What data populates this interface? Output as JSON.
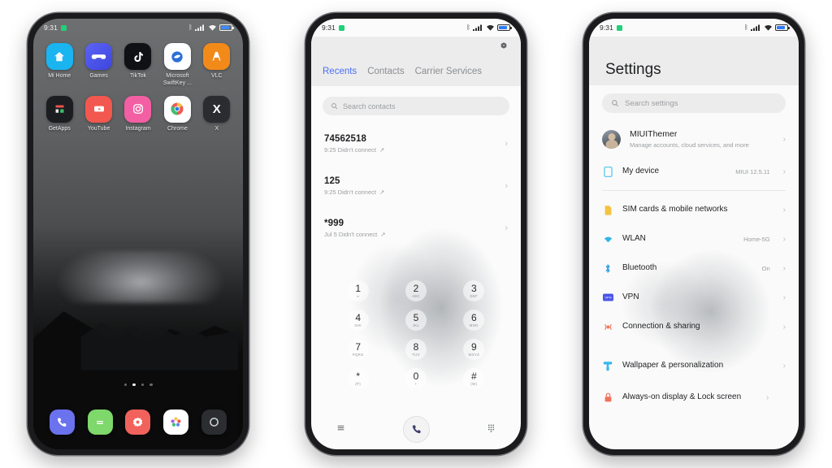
{
  "meta": {
    "background_color": "#ffffff",
    "device_frame_color": "#1b1b1d"
  },
  "status_bar": {
    "time": "9:31",
    "icons": {
      "bluetooth": "bluetooth-icon",
      "signal": "cellular-signal-icon",
      "wifi": "wifi-icon",
      "battery": "battery-icon"
    }
  },
  "phone1_home": {
    "apps_row1": [
      {
        "label": "Mi Home",
        "icon": "mi-home-icon",
        "color": "#1ab4f0",
        "glyph": "◆"
      },
      {
        "label": "Games",
        "icon": "games-icon",
        "color": "#4b55e8",
        "glyph": "Ἲe"
      },
      {
        "label": "TikTok",
        "icon": "tiktok-icon",
        "color": "#101114",
        "glyph": "♪"
      },
      {
        "label": "Microsoft SwiftKey ...",
        "icon": "swiftkey-icon",
        "color": "#ffffff",
        "glyph": "◉"
      },
      {
        "label": "VLC",
        "icon": "vlc-icon",
        "color": "#f28a1a",
        "glyph": "▲"
      }
    ],
    "apps_row2": [
      {
        "label": "GetApps",
        "icon": "getapps-icon",
        "color": "#1c1d20",
        "glyph": "■"
      },
      {
        "label": "YouTube",
        "icon": "youtube-icon",
        "color": "#f2584f",
        "glyph": "▶"
      },
      {
        "label": "Instagram",
        "icon": "instagram-icon",
        "color": "#f25fa3",
        "glyph": "◎"
      },
      {
        "label": "Chrome",
        "icon": "chrome-icon",
        "color": "#ffffff",
        "glyph": "◉"
      },
      {
        "label": "X",
        "icon": "x-icon",
        "color": "#2a2c30",
        "glyph": "X"
      }
    ],
    "page_dots": {
      "count": 4,
      "active_index": 1
    },
    "dock": [
      {
        "name": "phone-app",
        "icon": "phone-icon",
        "color": "#6b72ee",
        "glyph": "✆"
      },
      {
        "name": "messages-app",
        "icon": "messages-icon",
        "color": "#7ed86b",
        "glyph": "☰"
      },
      {
        "name": "settings-app",
        "icon": "settings-gear-icon",
        "color": "#f2625c",
        "glyph": "⚙"
      },
      {
        "name": "gallery-app",
        "icon": "gallery-icon",
        "color": "#ffffff",
        "glyph": "✸"
      },
      {
        "name": "camera-app",
        "icon": "camera-icon",
        "color": "#2b2d31",
        "glyph": "◎"
      }
    ]
  },
  "phone2_dialer": {
    "settings_icon": "gear-icon",
    "tabs": [
      {
        "label": "Recents",
        "active": true
      },
      {
        "label": "Contacts",
        "active": false
      },
      {
        "label": "Carrier Services",
        "active": false
      }
    ],
    "search": {
      "placeholder": "Search contacts",
      "icon": "search-icon"
    },
    "calls": [
      {
        "number": "74562518",
        "detail": "9:25 Didn't connect",
        "direction_icon": "outgoing-arrow-icon"
      },
      {
        "number": "125",
        "detail": "9:25 Didn't connect",
        "direction_icon": "outgoing-arrow-icon"
      },
      {
        "number": "*999",
        "detail": "Jul 5 Didn't connect",
        "direction_icon": "outgoing-arrow-icon"
      }
    ],
    "keypad": [
      {
        "digit": "1",
        "letters": "∞"
      },
      {
        "digit": "2",
        "letters": "ABC"
      },
      {
        "digit": "3",
        "letters": "DEF"
      },
      {
        "digit": "4",
        "letters": "GHI"
      },
      {
        "digit": "5",
        "letters": "JKL"
      },
      {
        "digit": "6",
        "letters": "MNO"
      },
      {
        "digit": "7",
        "letters": "PQRS"
      },
      {
        "digit": "8",
        "letters": "TUV"
      },
      {
        "digit": "9",
        "letters": "WXYZ"
      },
      {
        "digit": "*",
        "letters": "(P)"
      },
      {
        "digit": "0",
        "letters": "+"
      },
      {
        "digit": "#",
        "letters": "(W)"
      }
    ],
    "bottom_bar": {
      "menu_icon": "menu-lines-icon",
      "call_icon": "phone-call-icon",
      "keypad_icon": "dialpad-grid-icon"
    }
  },
  "phone3_settings": {
    "title": "Settings",
    "search": {
      "placeholder": "Search settings",
      "icon": "search-icon"
    },
    "account": {
      "name": "MIUIThemer",
      "subtitle": "Manage accounts, cloud services, and more",
      "avatar": "user-avatar"
    },
    "items": [
      {
        "label": "My device",
        "value": "MIUI 12.5.11",
        "icon": "device-icon",
        "color": "#5ec8f2"
      },
      {
        "label": "SIM cards & mobile networks",
        "value": "",
        "icon": "sim-card-icon",
        "color": "#f5c242"
      },
      {
        "label": "WLAN",
        "value": "Home-5G",
        "icon": "wifi-icon",
        "color": "#2fb8e8"
      },
      {
        "label": "Bluetooth",
        "value": "On",
        "icon": "bluetooth-icon",
        "color": "#2f9ee8"
      },
      {
        "label": "VPN",
        "value": "",
        "icon": "vpn-icon",
        "color": "#4b55e8"
      },
      {
        "label": "Connection & sharing",
        "value": "",
        "icon": "connection-sharing-icon",
        "color": "#f2775c"
      },
      {
        "label": "Wallpaper & personalization",
        "value": "",
        "icon": "wallpaper-brush-icon",
        "color": "#35b6f0"
      },
      {
        "label": "Always-on display & Lock screen",
        "value": "",
        "icon": "lock-icon",
        "color": "#f2705c"
      }
    ]
  }
}
